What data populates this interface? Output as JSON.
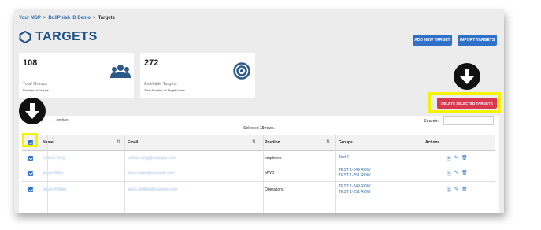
{
  "breadcrumb": [
    "Your MSP",
    "BullPhish ID Demo",
    "Targets"
  ],
  "page_title": "TARGETS",
  "buttons": {
    "add_new_target": "ADD NEW TARGET",
    "import_targets": "IMPORT TARGETS",
    "delete_selected": "DELETE SELECTED TARGETS"
  },
  "stats": [
    {
      "value": "108",
      "label": "Total Groups",
      "sublabel": "Number of Groups",
      "icon": "users-icon"
    },
    {
      "value": "272",
      "label": "Available Targets",
      "sublabel": "Total Number of Target Users",
      "icon": "target-icon"
    }
  ],
  "table": {
    "entries_label": "entries",
    "search_label": "Search:",
    "selected_prefix": "Selected",
    "selected_count": "10",
    "selected_suffix": "rows.",
    "columns": [
      "Name",
      "Email",
      "Position",
      "Groups",
      "Actions"
    ],
    "rows": [
      {
        "name": "Colleen King",
        "email": "colleen.king@example.com",
        "position": "employee",
        "groups": [
          "Test 1"
        ]
      },
      {
        "name": "Jason Miles",
        "email": "jason.miles@example.com",
        "position": "MWD",
        "groups": [
          "TEST 1-249 ROW",
          "TEST 1-251 ROW"
        ]
      },
      {
        "name": "Jason Phillips",
        "email": "jason.phillips@example.com",
        "position": "Operations",
        "groups": [
          "TEST 1-249 ROW",
          "TEST 1-251 ROW"
        ]
      }
    ]
  },
  "colors": {
    "accent": "#2f71c8",
    "danger": "#d83850",
    "highlight": "#f5f200",
    "title": "#1f4f86"
  }
}
